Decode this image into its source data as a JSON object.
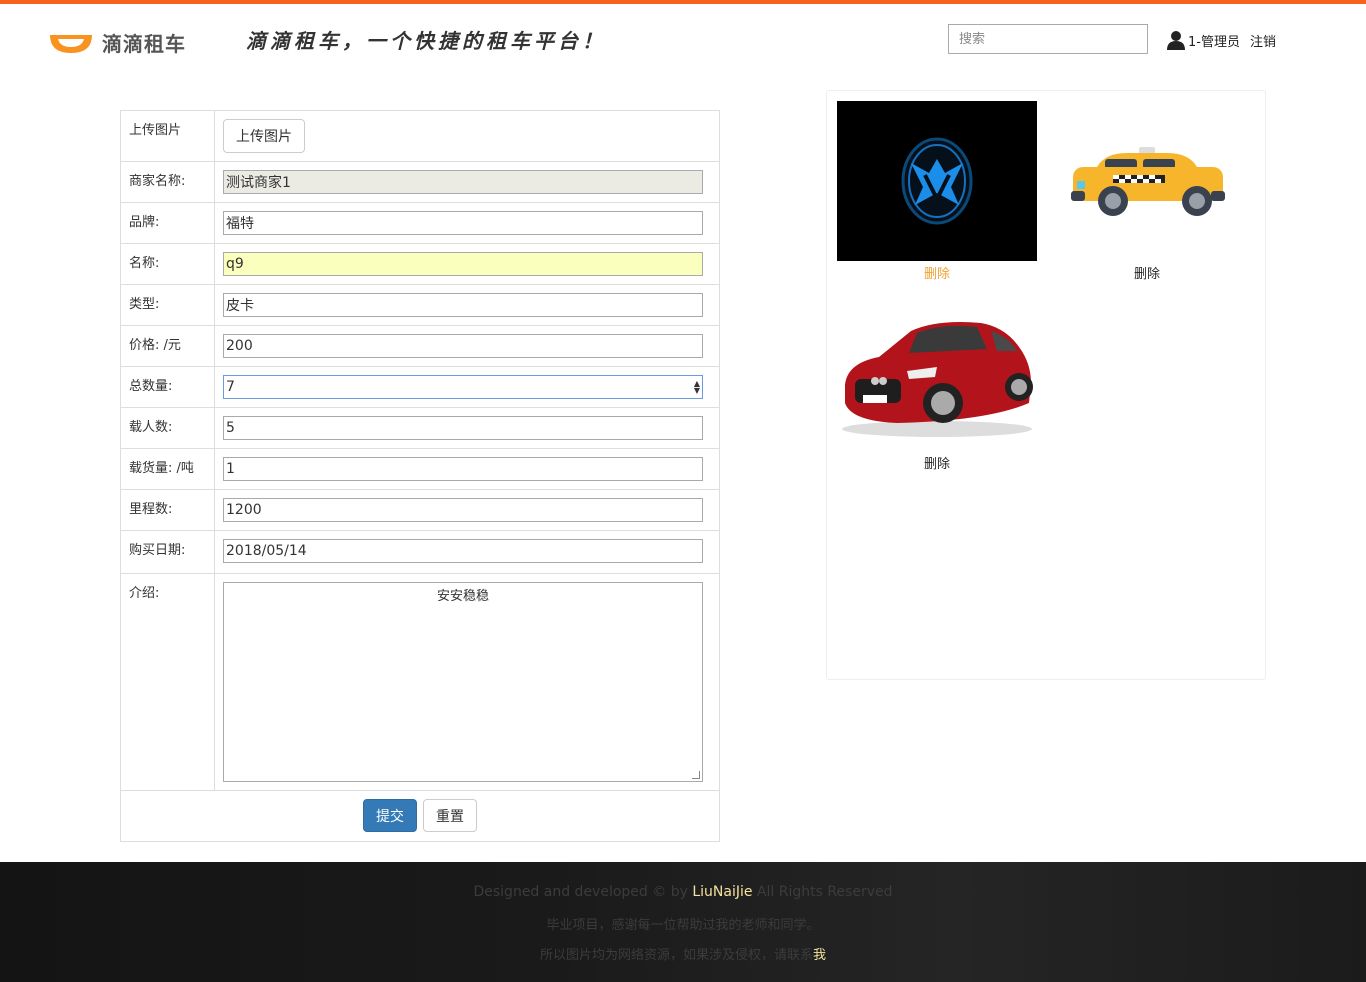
{
  "header": {
    "logo_text": "滴滴租车",
    "slogan": "滴滴租车，一个快捷的租车平台！",
    "search_placeholder": "搜索",
    "user_label": "1-管理员",
    "logout_label": "注销"
  },
  "form": {
    "upload_label": "上传图片",
    "upload_button": "上传图片",
    "fields": [
      {
        "label": "商家名称:",
        "value": "测试商家1"
      },
      {
        "label": "品牌:",
        "value": "福特"
      },
      {
        "label": "名称:",
        "value": "q9"
      },
      {
        "label": "类型:",
        "value": "皮卡"
      },
      {
        "label": "价格: /元",
        "value": "200"
      },
      {
        "label": "总数量:",
        "value": "7"
      },
      {
        "label": "载人数:",
        "value": "5"
      },
      {
        "label": "载货量: /吨",
        "value": "1"
      },
      {
        "label": "里程数:",
        "value": "1200"
      },
      {
        "label": "购买日期:",
        "value": "2018/05/14"
      }
    ],
    "intro_label": "介绍:",
    "intro_value": "安安稳稳",
    "submit_label": "提交",
    "reset_label": "重置"
  },
  "gallery": {
    "items": [
      {
        "image": "shield-eagle-logo-image",
        "delete_label": "删除",
        "delete_color": "#f0a030"
      },
      {
        "image": "yellow-taxi-image",
        "delete_label": "删除"
      },
      {
        "image": "red-sedan-image",
        "delete_label": "删除"
      }
    ]
  },
  "footer": {
    "line1_prefix": "Designed and developed © by ",
    "line1_author": "LiuNaiJie",
    "line1_suffix": " All Rights Reserved",
    "line2": "毕业项目，感谢每一位帮助过我的老师和同学。",
    "line3_prefix": "所以图片均为网络资源，如果涉及侵权，请联系",
    "line3_link": "我"
  },
  "colors": {
    "accent": "#f7631e",
    "primary": "#337ab7",
    "footer_highlight": "#f3e29e"
  }
}
